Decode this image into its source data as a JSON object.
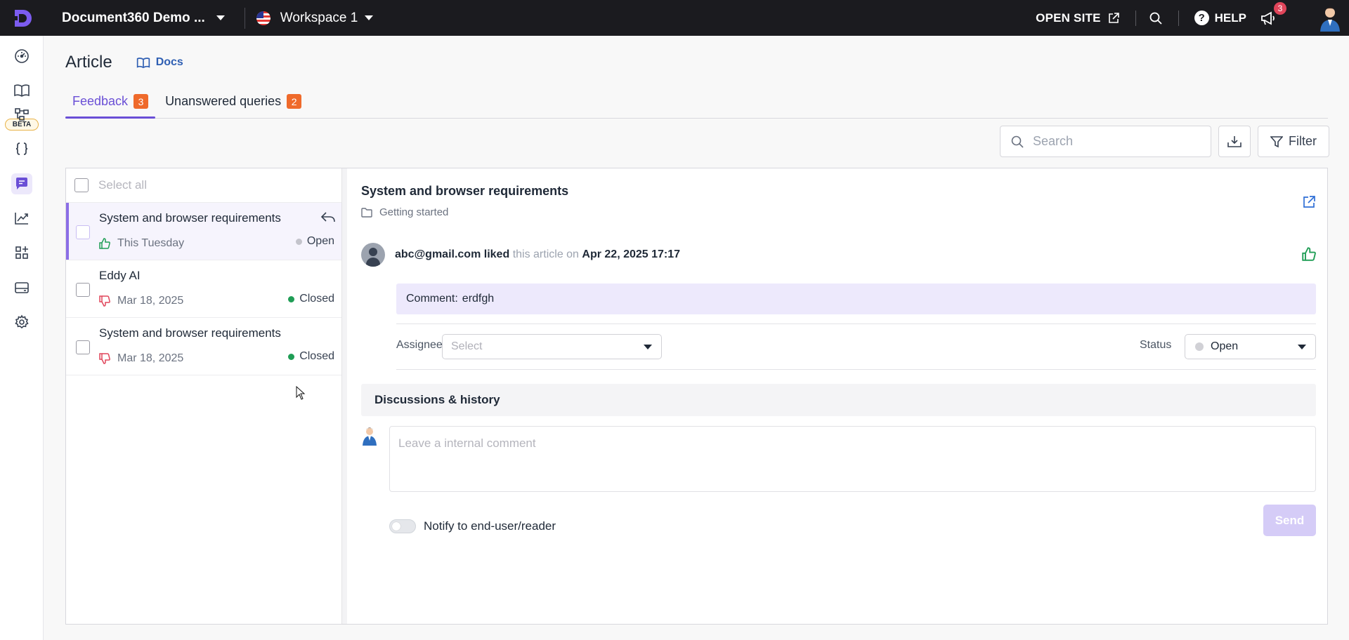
{
  "topbar": {
    "project_name": "Document360 Demo ...",
    "workspace": "Workspace 1",
    "open_site": "OPEN SITE",
    "help": "HELP",
    "notification_count": "3"
  },
  "rail": {
    "beta_label": "BETA",
    "icons": [
      "dashboard-icon",
      "book-icon",
      "workflow-icon",
      "api-icon",
      "feedback-icon",
      "analytics-icon",
      "apps-icon",
      "drive-icon",
      "settings-icon"
    ]
  },
  "page": {
    "title": "Article",
    "docs_link": "Docs"
  },
  "tabs": [
    {
      "label": "Feedback",
      "count": "3"
    },
    {
      "label": "Unanswered queries",
      "count": "2"
    }
  ],
  "toolbar": {
    "search_placeholder": "Search",
    "filter_label": "Filter"
  },
  "list": {
    "select_all": "Select all",
    "items": [
      {
        "title": "System and browser requirements",
        "date": "This Tuesday",
        "status": "Open",
        "reaction": "like"
      },
      {
        "title": "Eddy AI",
        "date": "Mar 18, 2025",
        "status": "Closed",
        "reaction": "dislike"
      },
      {
        "title": "System and browser requirements",
        "date": "Mar 18, 2025",
        "status": "Closed",
        "reaction": "dislike"
      }
    ]
  },
  "detail": {
    "title": "System and browser requirements",
    "category": "Getting started",
    "user_email": "abc@gmail.com",
    "action": "liked",
    "mid_text": "this article on",
    "timestamp": "Apr 22, 2025 17:17",
    "comment_label": "Comment:",
    "comment_text": "erdfgh",
    "assignee_label": "Assignee",
    "assignee_placeholder": "Select",
    "status_label": "Status",
    "status_value": "Open",
    "discussions_title": "Discussions & history",
    "comment_placeholder": "Leave a internal comment",
    "notify_label": "Notify to end-user/reader",
    "send_label": "Send"
  },
  "colors": {
    "accent": "#6a4fd6",
    "badge": "#ef6a2b",
    "open_dot": "#c4c4cc",
    "closed_dot": "#1f9d55",
    "like": "#1f9d55",
    "dislike": "#e0455a"
  }
}
